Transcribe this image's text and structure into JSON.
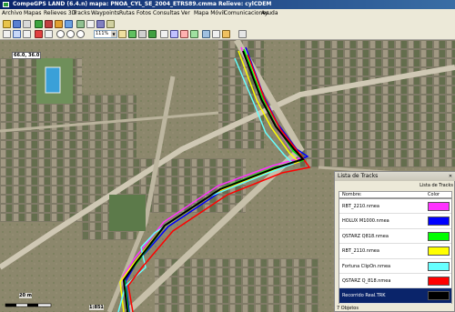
{
  "window": {
    "title": "CompeGPS LAND (6.4.n) mapa: PNOA_CYL_SE_2004_ETRS89.cmma Relieve: cylCDEM"
  },
  "menu": {
    "items": [
      "Archivo",
      "Mapas",
      "Relieves 3D",
      "Tracks",
      "Waypoints",
      "Rutas",
      "Fotos",
      "Consultas",
      "Ver",
      "Mapa Móvil",
      "Comunicaciones",
      "Ayuda"
    ]
  },
  "toolbar": {
    "zoom_value": "111%"
  },
  "map": {
    "coordinate_label": "66.0, 36.0",
    "scale_label": "20 m",
    "scale_ratio": "1:851"
  },
  "tracks_panel": {
    "title": "Lista de Tracks",
    "subtitle": "Lista de Tracks",
    "col_name": "Nombre:",
    "col_color": "Color",
    "footer": "7 Objetos",
    "items": [
      {
        "name": "RBT_2210.nmea",
        "color": "#ff33ff"
      },
      {
        "name": "HOLUX M1000.nmea",
        "color": "#0000ff"
      },
      {
        "name": "QSTARZ Q818.nmea",
        "color": "#00ff00"
      },
      {
        "name": "RBT_2110.nmea",
        "color": "#ffff00"
      },
      {
        "name": "Fortuna ClipOn.nmea",
        "color": "#66ffff"
      },
      {
        "name": "QSTARZ Q_818.nmea",
        "color": "#ff0000"
      },
      {
        "name": "Recorrido Real.TRK",
        "color": "#000000"
      }
    ]
  },
  "colors": {
    "title_bar": "#0a246a",
    "selected_row": "#0a246a"
  }
}
